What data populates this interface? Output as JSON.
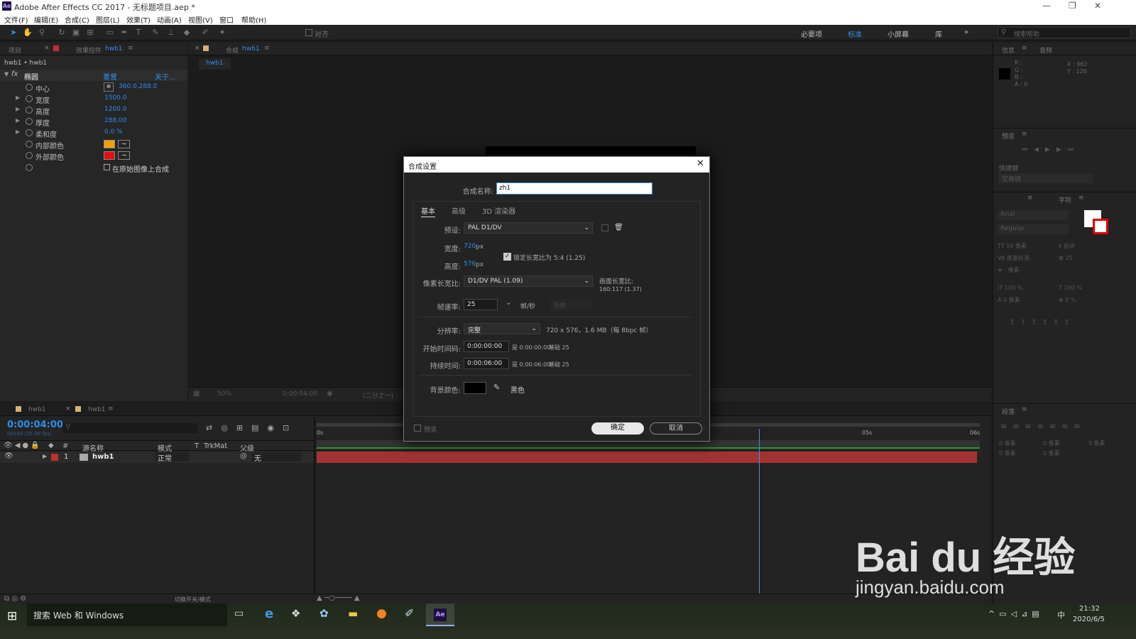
{
  "window": {
    "title": "Adobe After Effects CC 2017 - 无标题项目.aep *",
    "logo": "Ae"
  },
  "menu": [
    "文件(F)",
    "编辑(E)",
    "合成(C)",
    "图层(L)",
    "效果(T)",
    "动画(A)",
    "视图(V)",
    "窗口",
    "帮助(H)"
  ],
  "toolbar": {
    "align_label": "对齐",
    "workspaces": [
      "必要项",
      "标准",
      "小屏幕",
      "库"
    ],
    "search_placeholder": "搜索帮助"
  },
  "left_panel": {
    "tab_project": "项目",
    "tab_effects": "效果控件",
    "tab_effects_target": "hwb1",
    "breadcrumb": "hwb1 • hwb1",
    "effect_name": "椭圆",
    "reset": "重置",
    "about": "关于...",
    "props": [
      {
        "label": "中心",
        "value": "360.0,288.0"
      },
      {
        "label": "宽度",
        "value": "1500.0"
      },
      {
        "label": "高度",
        "value": "1200.0"
      },
      {
        "label": "厚度",
        "value": "288.00"
      },
      {
        "label": "柔和度",
        "value": "0.0 %"
      },
      {
        "label": "内部颜色",
        "value": ""
      },
      {
        "label": "外部颜色",
        "value": ""
      }
    ],
    "composite_label": "在原始图像上合成",
    "inner_color": "#f0a400",
    "outer_color": "#e01010"
  },
  "comp_panel": {
    "tab_label": "合成",
    "tab_name": "hwb1",
    "sub_tab": "hwb1",
    "zoom": "50%",
    "time": "0:00:04:00",
    "res": "(二分之一)"
  },
  "dialog": {
    "title": "合成设置",
    "name_label": "合成名称:",
    "name_value": "zh1",
    "tabs": [
      "基本",
      "高级",
      "3D 渲染器"
    ],
    "preset_label": "预设:",
    "preset_value": "PAL D1/DV",
    "width_label": "宽度:",
    "width_value": "720",
    "height_label": "高度:",
    "height_value": "576",
    "unit_px": "px",
    "lock_label": "锁定长宽比为 5:4 (1.25)",
    "pixel_label": "像素长宽比:",
    "pixel_value": "D1/DV PAL (1.09)",
    "frame_aspect_label": "画面长宽比:",
    "frame_aspect_value": "160:117 (1.37)",
    "fps_label": "帧速率:",
    "fps_value": "25",
    "fps_unit": "帧/秒",
    "fps_drop": "丢帧",
    "res_label": "分辨率:",
    "res_value": "完整",
    "res_info": "720 x 576，1.6 MB（每 8bpc 帧）",
    "start_label": "开始时间码:",
    "start_value": "0:00:00:00",
    "start_info": "是 0:00:00:00",
    "base": "基础 25",
    "dur_label": "持续时间:",
    "dur_value": "0:00:06:00",
    "dur_info": "是 0:00:06:00",
    "bg_label": "背景颜色:",
    "bg_name": "黑色",
    "bg_color": "#000000",
    "preview_label": "预览",
    "ok": "确定",
    "cancel": "取消"
  },
  "right_panel": {
    "info_tab": "信息",
    "audio_tab": "音频",
    "rgba": [
      "R :",
      "G :",
      "B :",
      "A : 0"
    ],
    "xy": [
      "X : 962",
      "Y : 126"
    ],
    "preview_tab": "预览",
    "shortcut_label": "快捷键",
    "shortcut_value": "空格键",
    "char_tab": "字符",
    "para_tab": "段落",
    "font": "Arial",
    "style": "Regular",
    "font_size": "19 像素",
    "leading": "自动",
    "tracking": "度量标准",
    "track_val": "25",
    "indent": "- 像素",
    "scale1": "100 %",
    "scale2": "100 %",
    "baseline": "0 像素",
    "tsume": "0 %",
    "para_vals": [
      "0 像素",
      "0 像素",
      "0 像素",
      "0 像素",
      "0 像素"
    ]
  },
  "timeline": {
    "tab1": "hwb1",
    "tab2": "hwb1",
    "time": "0:00:04:00",
    "fps_info": "00100 (25.00 fps)",
    "cols": [
      "源名称",
      "模式",
      "T",
      "TrkMat",
      "父级"
    ],
    "layer_num": "1",
    "layer_name": "hwb1",
    "layer_mode": "正常",
    "layer_parent": "无",
    "ruler": [
      "0s",
      "05s",
      "06s"
    ],
    "footer": "切换开关/模式",
    "playhead_fraction": 0.667
  },
  "taskbar": {
    "search": "搜索 Web 和 Windows",
    "time": "21:32",
    "date": "2020/6/5",
    "ime": "中"
  },
  "watermark": {
    "brand": "Bai du 经验",
    "url": "jingyan.baidu.com"
  }
}
